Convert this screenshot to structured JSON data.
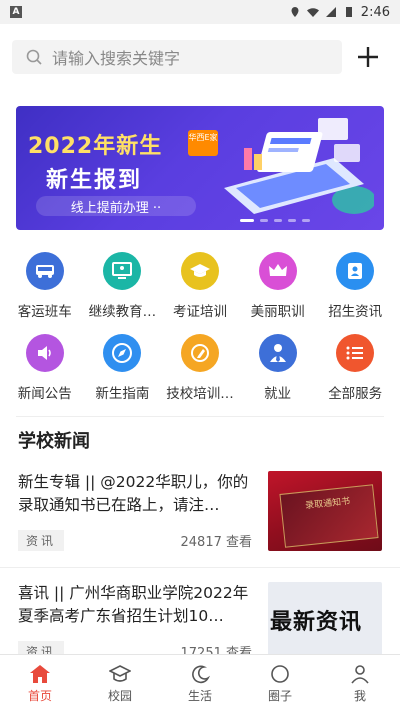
{
  "status_bar": {
    "time": "2:46",
    "left_badge": "A"
  },
  "search": {
    "placeholder": "请输入搜索关键字"
  },
  "banner": {
    "line1": "2022年新生",
    "badge": "华西E家",
    "line2": "新生报到",
    "line3": "线上提前办理 ··"
  },
  "categories": [
    {
      "label": "客运班车",
      "color": "#3d6fd8",
      "icon": "bus-icon"
    },
    {
      "label": "继续教育…",
      "color": "#1bb6a6",
      "icon": "presentation-icon"
    },
    {
      "label": "考证培训",
      "color": "#e8c21e",
      "icon": "graduation-cap-icon"
    },
    {
      "label": "美丽职训",
      "color": "#d94fd6",
      "icon": "crown-icon"
    },
    {
      "label": "招生资讯",
      "color": "#2a8ff0",
      "icon": "id-card-icon"
    },
    {
      "label": "新闻公告",
      "color": "#b455e0",
      "icon": "speaker-icon"
    },
    {
      "label": "新生指南",
      "color": "#2f8ff0",
      "icon": "compass-icon"
    },
    {
      "label": "技校培训…",
      "color": "#f5a623",
      "icon": "edit-icon"
    },
    {
      "label": "就业",
      "color": "#3d6fd8",
      "icon": "person-tie-icon"
    },
    {
      "label": "全部服务",
      "color": "#f0562e",
      "icon": "list-icon"
    }
  ],
  "section_title": "学校新闻",
  "news": [
    {
      "title": "新生专辑 || @2022华职儿，你的录取通知书已在路上，请注…",
      "tag": "资讯",
      "views": "24817 查看",
      "thumb_text": "录取通知书"
    },
    {
      "title": "喜讯 || 广州华商职业学院2022年夏季高考广东省招生计划10…",
      "tag": "资讯",
      "views": "17251 查看",
      "thumb_text": "最新资讯"
    }
  ],
  "tabs": [
    {
      "label": "首页",
      "icon": "home-icon",
      "active": true
    },
    {
      "label": "校园",
      "icon": "campus-icon",
      "active": false
    },
    {
      "label": "生活",
      "icon": "moon-icon",
      "active": false
    },
    {
      "label": "圈子",
      "icon": "circle-icon",
      "active": false
    },
    {
      "label": "我",
      "icon": "user-icon",
      "active": false
    }
  ],
  "accent_color": "#e84a3c"
}
